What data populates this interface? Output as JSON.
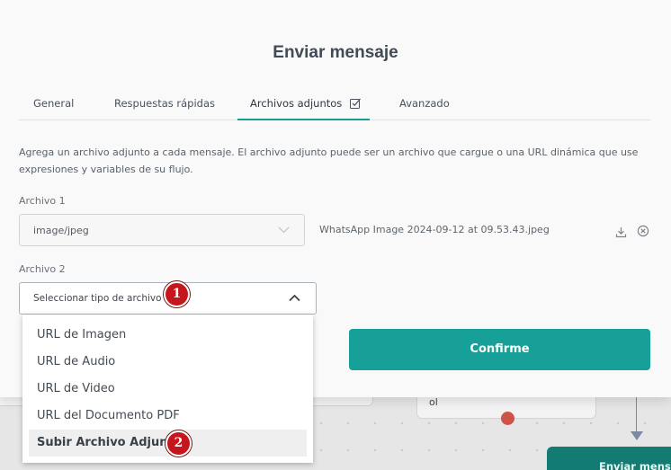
{
  "modal": {
    "title": "Enviar mensaje",
    "tabs": [
      {
        "label": "General"
      },
      {
        "label": "Respuestas rápidas"
      },
      {
        "label": "Archivos adjuntos"
      },
      {
        "label": "Avanzado"
      }
    ],
    "active_tab": "Archivos adjuntos",
    "description": "Agrega un archivo adjunto a cada mensaje. El archivo adjunto puede ser un archivo que cargue o una URL dinámica que use expresiones y variables de su flujo.",
    "attachment1": {
      "label": "Archivo 1",
      "type_value": "image/jpeg",
      "file_name": "WhatsApp Image 2024-09-12 at 09.53.43.jpeg"
    },
    "attachment2": {
      "label": "Archivo 2",
      "placeholder": "Seleccionar tipo de archivo"
    },
    "dropdown_options": [
      {
        "label": "URL de Imagen"
      },
      {
        "label": "URL de Audio"
      },
      {
        "label": "URL de Video"
      },
      {
        "label": "URL del Documento PDF"
      },
      {
        "label": "Subir Archivo Adjunto"
      }
    ],
    "highlighted_option": "Subir Archivo Adjunto",
    "confirm_label": "Confirme"
  },
  "annotations": {
    "badge1": "1",
    "badge2": "2"
  },
  "background": {
    "node_text": "ol",
    "green_node_label": "Enviar mensaje"
  },
  "colors": {
    "accent": "#17a097",
    "badge": "#c4161c",
    "flow_node_green": "#127c72",
    "dot_red": "#cf5448"
  },
  "icons": [
    "check-square-icon",
    "chevron-down-icon",
    "download-icon",
    "close-circle-icon",
    "chevron-up-icon"
  ]
}
